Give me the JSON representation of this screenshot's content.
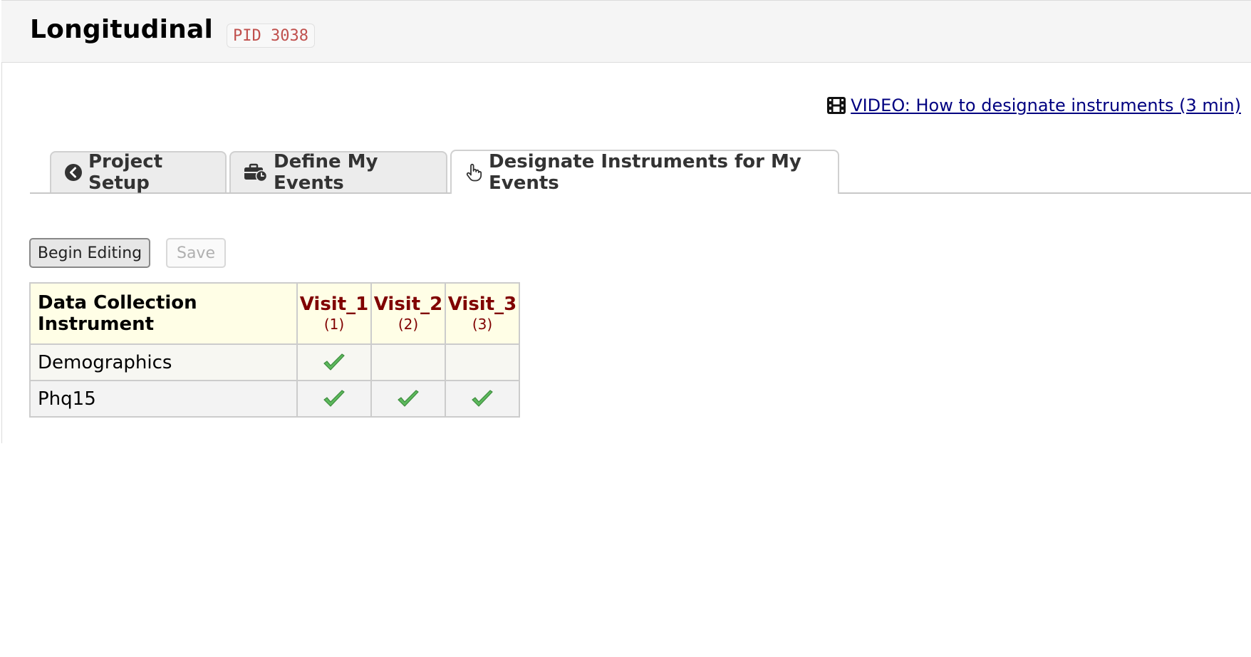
{
  "header": {
    "title": "Longitudinal",
    "pid_badge": "PID 3038"
  },
  "video": {
    "icon": "film-icon",
    "label": "VIDEO: How to designate instruments (3 min)"
  },
  "tabs": [
    {
      "icon": "chevron-circle-left-icon",
      "label": "Project Setup",
      "active": false
    },
    {
      "icon": "briefcase-clock-icon",
      "label": "Define My Events",
      "active": false
    },
    {
      "icon": "hand-pointer-icon",
      "label": "Designate Instruments for My Events",
      "active": true
    }
  ],
  "toolbar": {
    "begin_editing_label": "Begin Editing",
    "save_label": "Save"
  },
  "grid": {
    "header_label": "Data Collection Instrument",
    "events": [
      {
        "name": "Visit_1",
        "num": "(1)"
      },
      {
        "name": "Visit_2",
        "num": "(2)"
      },
      {
        "name": "Visit_3",
        "num": "(3)"
      }
    ],
    "rows": [
      {
        "instrument": "Demographics",
        "designated": [
          true,
          false,
          false
        ]
      },
      {
        "instrument": "Phq15",
        "designated": [
          true,
          true,
          true
        ]
      }
    ]
  },
  "colors": {
    "event_header_text": "#800000",
    "header_bg": "#fffee6",
    "check_green": "#5cb85c",
    "pid_text": "#c0504d",
    "link": "#000080"
  }
}
